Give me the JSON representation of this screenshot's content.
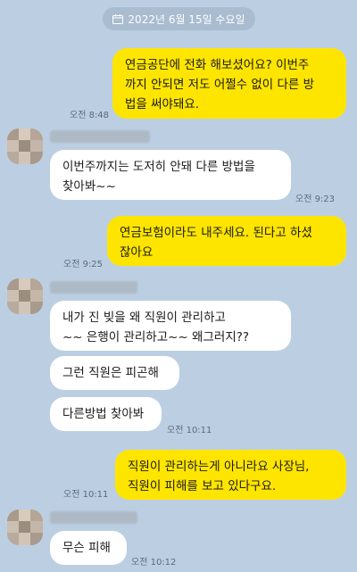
{
  "date_divider": {
    "icon": "calendar-icon",
    "text": "2022년 6월 15일 수요일"
  },
  "messages": [
    {
      "from": "me",
      "text": "연금공단에 전화 해보셨어요? 이번주\n까지 안되면 저도 어쩔수 없이 다른 방\n법을 써야돼요.",
      "time": "오전 8:48"
    },
    {
      "from": "other",
      "text": "이번주까지는 도저히 안돼 다른 방법을\n찾아봐~~",
      "time": "오전 9:23"
    },
    {
      "from": "me",
      "text": "연금보험이라도 내주세요. 된다고 하셨\n잖아요",
      "time": "오전 9:25"
    },
    {
      "from": "other",
      "text": "내가 진 빚을 왜     직원이  관리하고\n~~  은행이 관리하고~~  왜그러지??",
      "time": ""
    },
    {
      "from": "other",
      "text": "그런 직원은 피곤해",
      "time": ""
    },
    {
      "from": "other",
      "text": "다른방법 찾아봐",
      "time": "오전 10:11"
    },
    {
      "from": "me",
      "text": "직원이 관리하는게 아니라요 사장님,\n직원이 피해를 보고 있다구요.",
      "time": "오전 10:11"
    },
    {
      "from": "other",
      "text": "무슨 피해",
      "time": "오전 10:12"
    }
  ],
  "colors": {
    "background": "#bccfe2",
    "my_bubble": "#fee500",
    "their_bubble": "#ffffff"
  }
}
